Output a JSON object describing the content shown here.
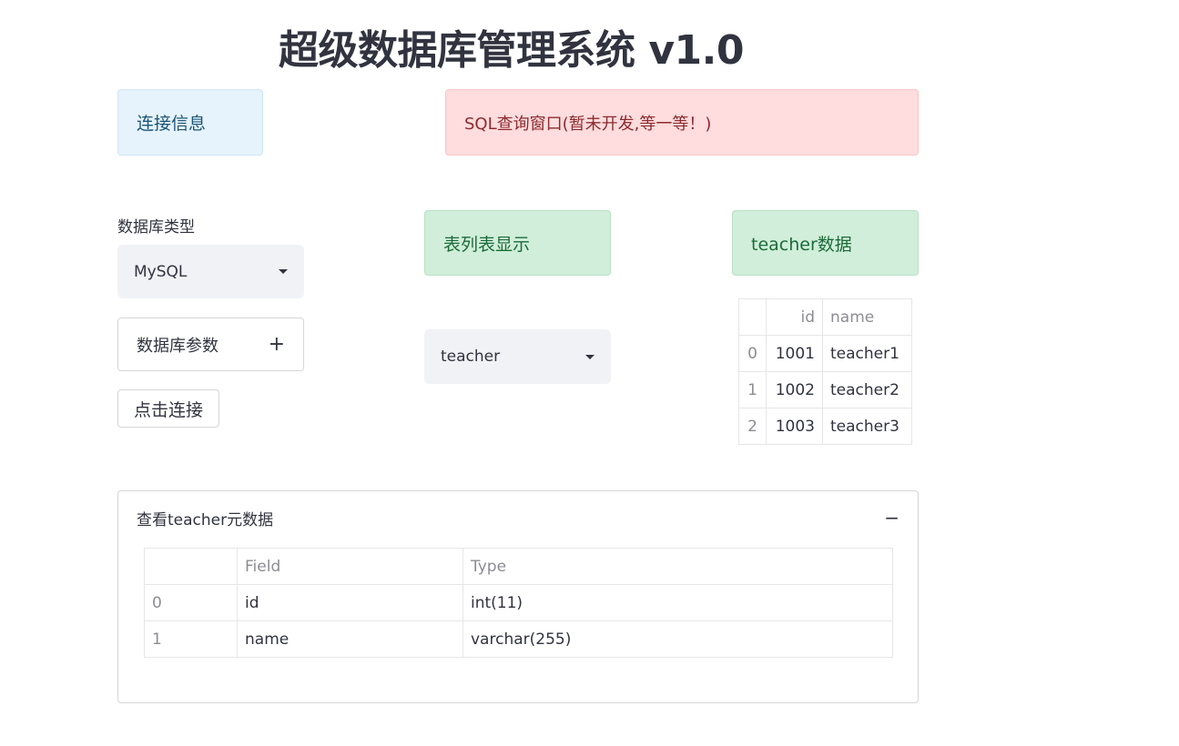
{
  "title": "超级数据库管理系统 v1.0",
  "alerts": {
    "connection_info": "连接信息",
    "sql_window": "SQL查询窗口(暂未开发,等一等！)",
    "table_list": "表列表显示",
    "table_data": "teacher数据"
  },
  "db_type": {
    "label": "数据库类型",
    "selected": "MySQL"
  },
  "db_params": {
    "label": "数据库参数",
    "icon": "plus-icon"
  },
  "connect_button": "点击连接",
  "table_select": {
    "selected": "teacher"
  },
  "teacher_table": {
    "columns": [
      "",
      "id",
      "name"
    ],
    "rows": [
      [
        "0",
        "1001",
        "teacher1"
      ],
      [
        "1",
        "1002",
        "teacher2"
      ],
      [
        "2",
        "1003",
        "teacher3"
      ]
    ]
  },
  "metadata": {
    "expander_label": "查看teacher元数据",
    "icon": "minus-icon",
    "columns": [
      "",
      "Field",
      "Type"
    ],
    "rows": [
      [
        "0",
        "id",
        "int(11)"
      ],
      [
        "1",
        "name",
        "varchar(255)"
      ]
    ]
  }
}
